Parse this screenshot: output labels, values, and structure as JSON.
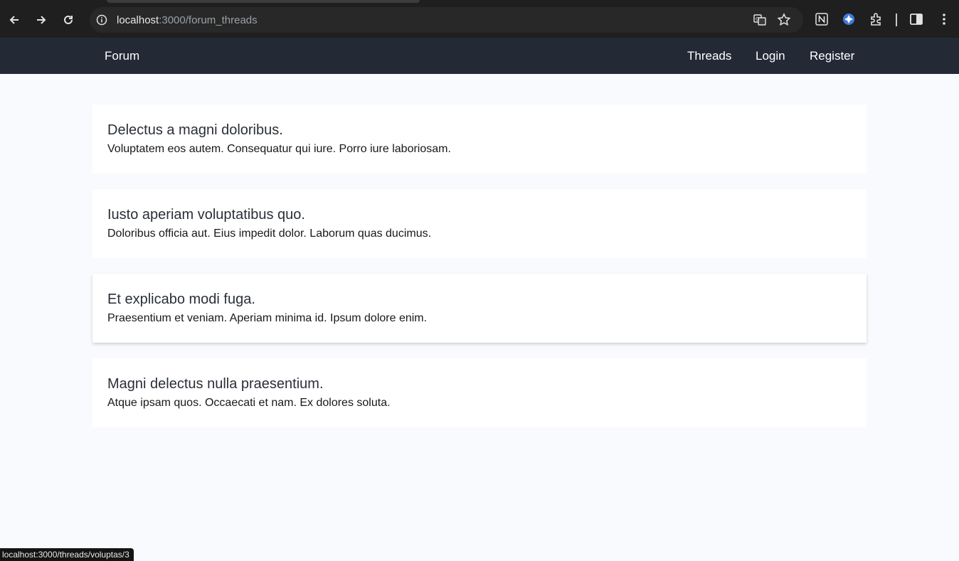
{
  "browser": {
    "url_host": "localhost",
    "url_path": ":3000/forum_threads",
    "status_url": "localhost:3000/threads/voluptas/3",
    "icons": [
      "back-icon",
      "forward-icon",
      "reload-icon",
      "site-info-icon",
      "translate-icon",
      "bookmark-star-icon",
      "notion-icon",
      "extension-app-icon",
      "extensions-puzzle-icon",
      "side-panel-icon",
      "menu-kebab-icon"
    ]
  },
  "navbar": {
    "brand": "Forum",
    "links": [
      {
        "label": "Threads"
      },
      {
        "label": "Login"
      },
      {
        "label": "Register"
      }
    ]
  },
  "threads": [
    {
      "title": "Delectus a magni doloribus.",
      "excerpt": "Voluptatem eos autem. Consequatur qui iure. Porro iure laboriosam."
    },
    {
      "title": "Iusto aperiam voluptatibus quo.",
      "excerpt": "Doloribus officia aut. Eius impedit dolor. Laborum quas ducimus."
    },
    {
      "title": "Et explicabo modi fuga.",
      "excerpt": "Praesentium et veniam. Aperiam minima id. Ipsum dolore enim."
    },
    {
      "title": "Magni delectus nulla praesentium.",
      "excerpt": "Atque ipsam quos. Occaecati et nam. Ex dolores soluta."
    }
  ],
  "colors": {
    "browser_chrome": "#1f1f1f",
    "navbar_bg": "#232a36",
    "page_bg": "#f8fafd",
    "card_bg": "#ffffff"
  }
}
